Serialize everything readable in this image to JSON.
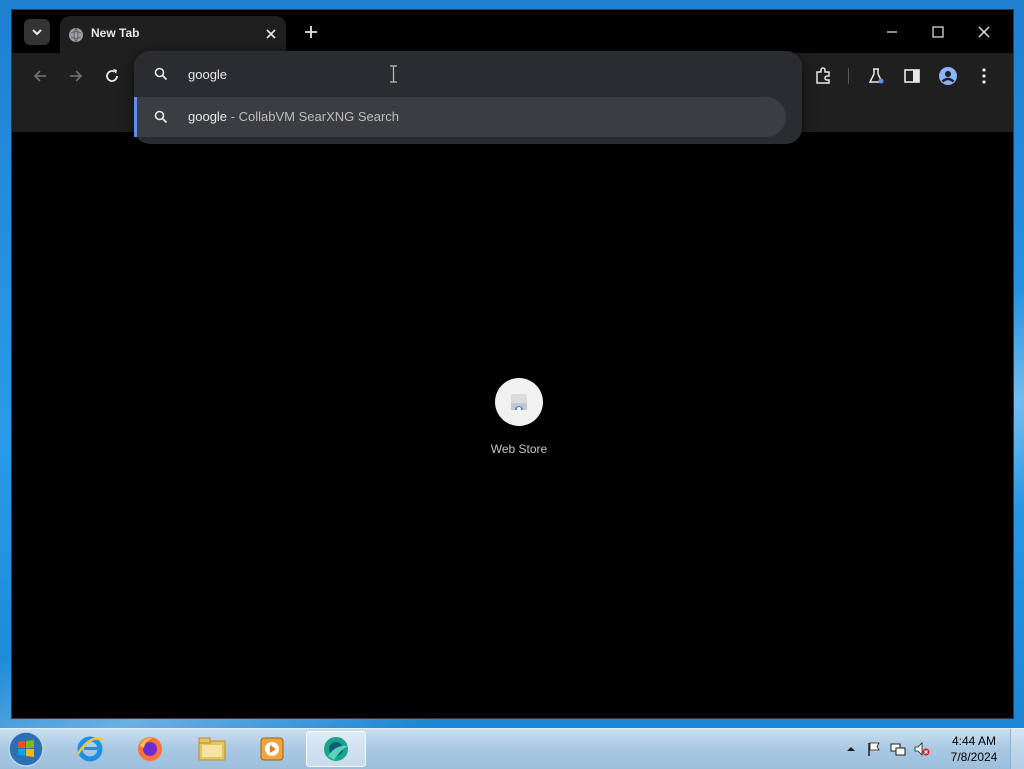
{
  "tab": {
    "title": "New Tab"
  },
  "omnibox": {
    "value": "google",
    "suggestion": {
      "query": "google",
      "separator": "-",
      "engine": "CollabVM SearXNG Search"
    }
  },
  "shortcuts": [
    {
      "label": "Web Store"
    }
  ],
  "taskbar": {
    "apps": [
      "internet-explorer",
      "firefox",
      "file-explorer",
      "media-player",
      "browser"
    ],
    "clock": {
      "time": "4:44 AM",
      "date": "7/8/2024"
    }
  },
  "colors": {
    "accent": "#5b8ef0",
    "background": "#000000",
    "chrome": "#1f1f1f"
  }
}
